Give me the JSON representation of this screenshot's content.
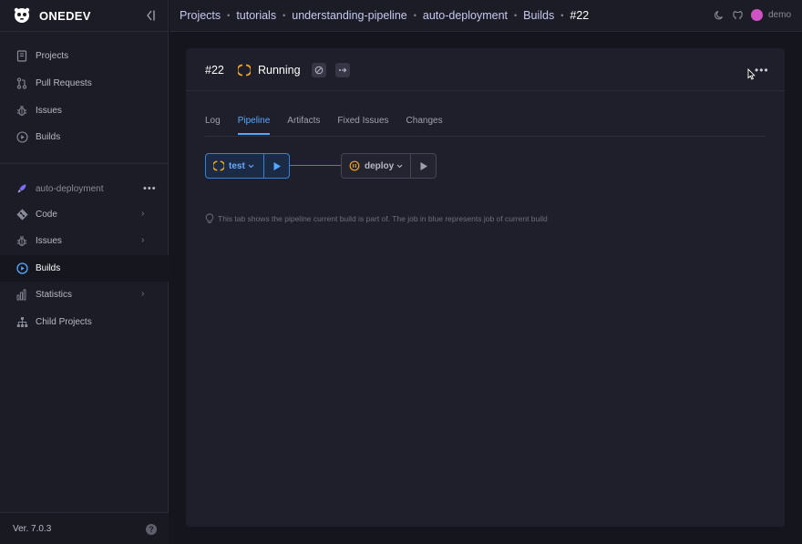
{
  "app": {
    "brand": "ONEDEV",
    "version": "Ver. 7.0.3"
  },
  "sidebar": {
    "global_items": [
      {
        "label": "Projects",
        "icon": "projects-icon"
      },
      {
        "label": "Pull Requests",
        "icon": "pull-request-icon"
      },
      {
        "label": "Issues",
        "icon": "bug-icon"
      },
      {
        "label": "Builds",
        "icon": "play-circle-icon"
      }
    ],
    "project": {
      "name": "auto-deployment",
      "more": "•••"
    },
    "project_items": [
      {
        "label": "Code",
        "icon": "code-icon",
        "expandable": true
      },
      {
        "label": "Issues",
        "icon": "bug-icon",
        "expandable": true
      },
      {
        "label": "Builds",
        "icon": "play-circle-icon",
        "active": true
      },
      {
        "label": "Statistics",
        "icon": "bar-chart-icon",
        "expandable": true
      },
      {
        "label": "Child Projects",
        "icon": "hierarchy-icon"
      }
    ],
    "chevron": "›",
    "help": "?"
  },
  "breadcrumb": {
    "items": [
      "Projects",
      "tutorials",
      "understanding-pipeline",
      "auto-deployment",
      "Builds",
      "#22"
    ],
    "separator": "•"
  },
  "topbar": {
    "user": "demo"
  },
  "build": {
    "number": "#22",
    "status": "Running",
    "more": "•••",
    "tabs": [
      "Log",
      "Pipeline",
      "Artifacts",
      "Fixed Issues",
      "Changes"
    ],
    "active_tab": "Pipeline",
    "jobs": [
      {
        "name": "test",
        "status": "running",
        "current": true
      },
      {
        "name": "deploy",
        "status": "waiting",
        "current": false
      }
    ],
    "tip": "This tab shows the pipeline current build is part of. The job in blue represents job of current build"
  },
  "colors": {
    "accent": "#53a9ff",
    "running": "#f2a51c",
    "background": "#15151d",
    "panel": "#1f1f2b"
  }
}
